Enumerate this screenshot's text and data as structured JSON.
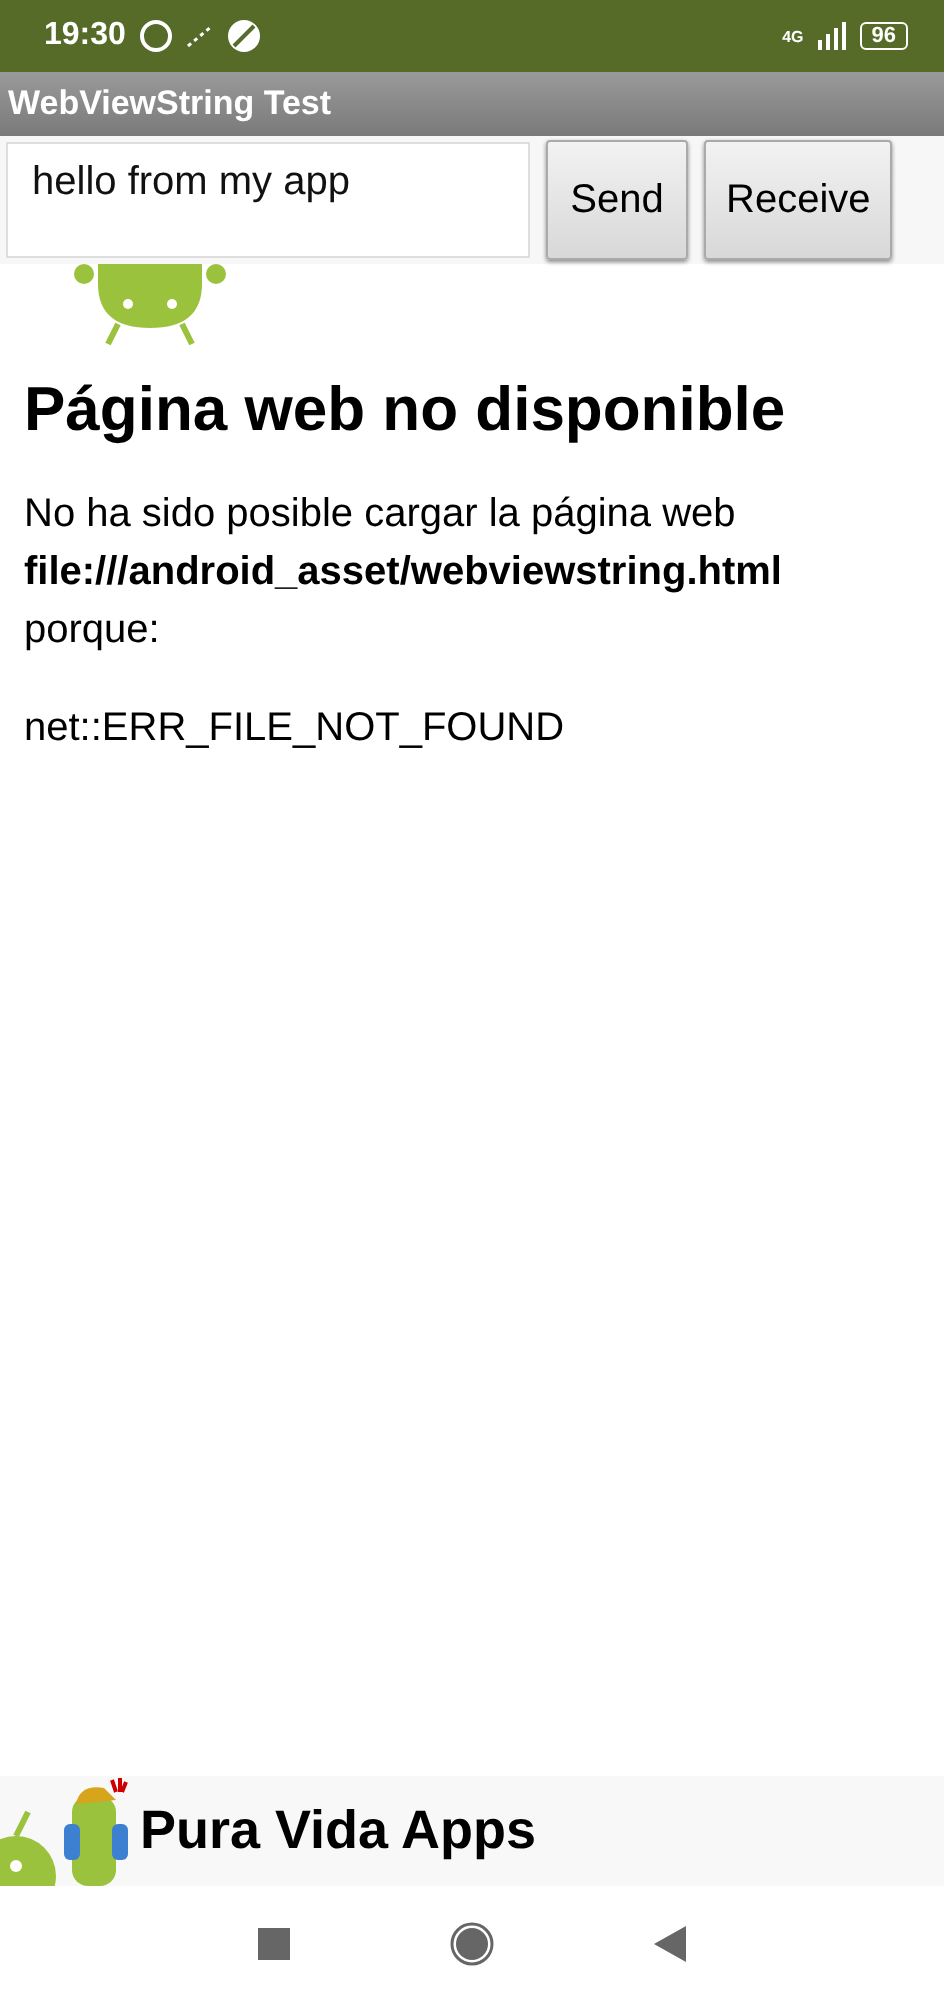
{
  "status_bar": {
    "time": "19:30",
    "network": "4G",
    "battery": "96"
  },
  "app_bar": {
    "title": "WebViewString Test"
  },
  "form": {
    "message": {
      "value": "hello from my app"
    },
    "buttons": [
      "Send",
      "Receive"
    ]
  },
  "webview": {
    "heading": "Página web no disponible",
    "message": "No ha sido posible cargar la página web **file:///android_asset/webviewstring.html** porque:",
    "error": "net::ERR_FILE_NOT_FOUND"
  },
  "banner": {
    "title": "Pura Vida Apps"
  }
}
